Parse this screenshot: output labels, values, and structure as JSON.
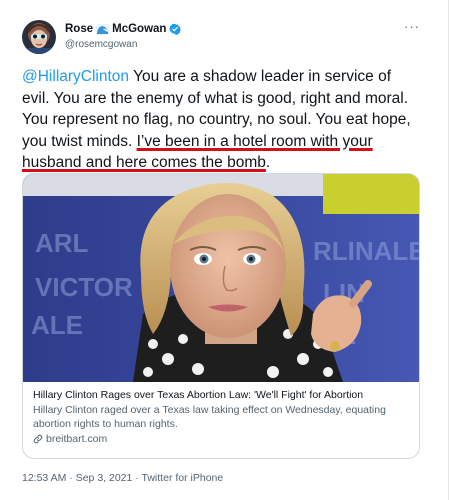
{
  "author": {
    "name_first": "Rose",
    "name_last": "McGowan",
    "handle": "@rosemcgowan",
    "verified": true,
    "icons": [
      "wave-emoji-icon",
      "verified-badge-icon"
    ]
  },
  "more_menu": "···",
  "tweet": {
    "mention": "@HillaryClinton",
    "text_before_underline": " You are a shadow leader in service of evil. You are the enemy of what is good, right and moral. You represent no flag, no country, no soul. You eat hope, you twist minds. ",
    "text_underlined": "I’ve been in a hotel room with your husband and here comes the bomb",
    "text_after": "."
  },
  "link_card": {
    "title": "Hillary Clinton Rages over Texas Abortion Law: 'We'll Fight' for Abortion",
    "description": "Hillary Clinton raged over a Texas law taking effect on Wednesday, equating abortion rights to human rights.",
    "domain": "breitbart.com",
    "background_text": [
      "ARL",
      "VICTOR",
      "ALE",
      "RLINALE",
      "LIN",
      "LE"
    ]
  },
  "meta": {
    "time": "12:53 AM",
    "separator": " · ",
    "date": "Sep 3, 2021",
    "source": "Twitter for iPhone"
  },
  "colors": {
    "link": "#1d9bf0",
    "underline": "#d40f1a",
    "secondary_text": "#536471",
    "border": "#cfd9de"
  }
}
